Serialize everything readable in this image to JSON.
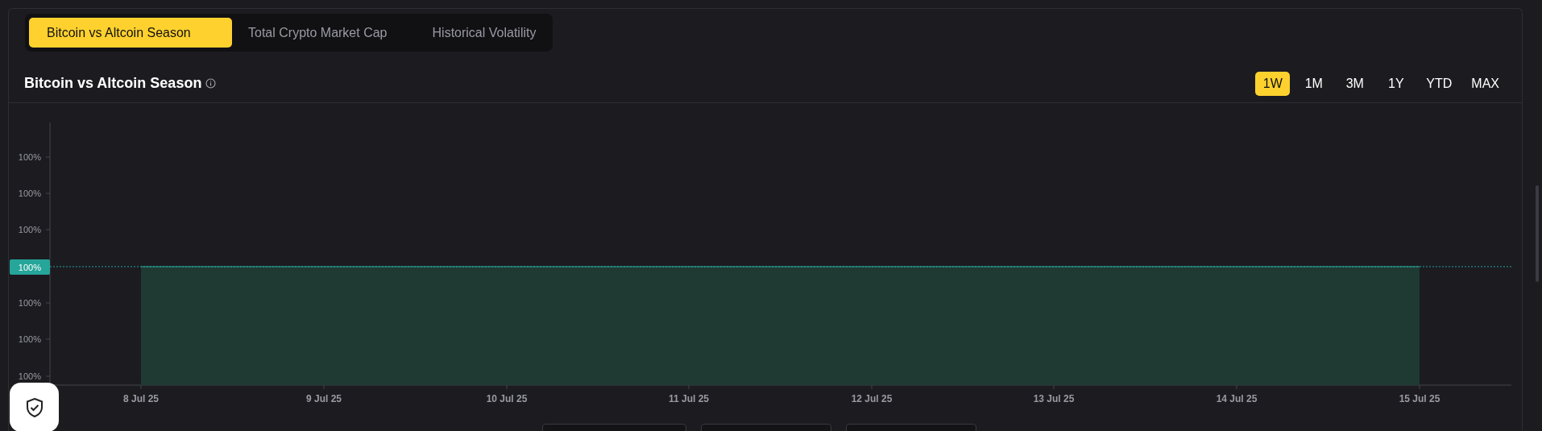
{
  "tabs": [
    {
      "label": "Bitcoin vs Altcoin Season",
      "selected": true
    },
    {
      "label": "Total Crypto Market Cap",
      "selected": false
    },
    {
      "label": "Historical Volatility",
      "selected": false
    }
  ],
  "panel": {
    "title": "Bitcoin vs Altcoin Season"
  },
  "ranges": [
    {
      "label": "1W",
      "selected": true
    },
    {
      "label": "1M",
      "selected": false
    },
    {
      "label": "3M",
      "selected": false
    },
    {
      "label": "1Y",
      "selected": false
    },
    {
      "label": "YTD",
      "selected": false
    },
    {
      "label": "MAX",
      "selected": false
    }
  ],
  "chart": {
    "y_labels": [
      "100%",
      "100%",
      "100%",
      "100%",
      "100%",
      "100%"
    ],
    "current_value": "100%",
    "x_labels": [
      "8 Jul 25",
      "9 Jul 25",
      "10 Jul 25",
      "11 Jul 25",
      "12 Jul 25",
      "13 Jul 25",
      "14 Jul 25",
      "15 Jul 25"
    ]
  }
}
